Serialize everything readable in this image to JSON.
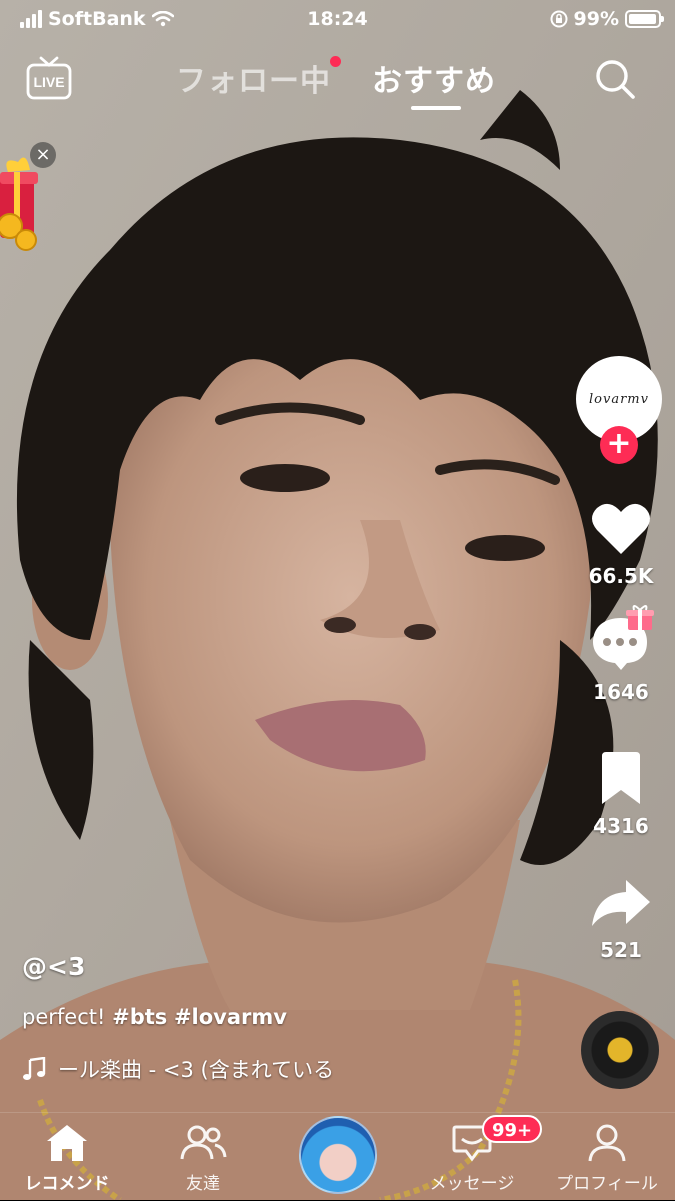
{
  "status_bar": {
    "carrier": "SoftBank",
    "time": "18:24",
    "battery_percent": "99%",
    "battery_level": 0.99
  },
  "top_nav": {
    "live_icon": "live-tv-icon",
    "tabs": [
      {
        "label": "フォロー中",
        "has_dot": true,
        "active": false
      },
      {
        "label": "おすすめ",
        "active": true
      }
    ],
    "search_icon": "search-icon"
  },
  "creator": {
    "avatar_text": "lovarmv",
    "follow_icon": "plus-icon"
  },
  "actions": {
    "likes": "66.5K",
    "comments": "1646",
    "bookmarks": "4316",
    "shares": "521"
  },
  "post": {
    "author": "@<3",
    "caption_text": "perfect!",
    "hashtags": [
      "#bts",
      "#lovarmv"
    ],
    "music": "ール楽曲 - <3 (含まれている"
  },
  "bottom_nav": {
    "items": [
      {
        "label": "レコメンド",
        "icon": "home-icon",
        "active": true
      },
      {
        "label": "友達",
        "icon": "friends-icon"
      },
      {
        "label": "",
        "icon": "create-avatar"
      },
      {
        "label": "メッセージ",
        "icon": "inbox-icon",
        "badge": "99+"
      },
      {
        "label": "プロフィール",
        "icon": "profile-icon"
      }
    ]
  },
  "colors": {
    "accent": "#fe2c55",
    "text": "#ffffff"
  }
}
